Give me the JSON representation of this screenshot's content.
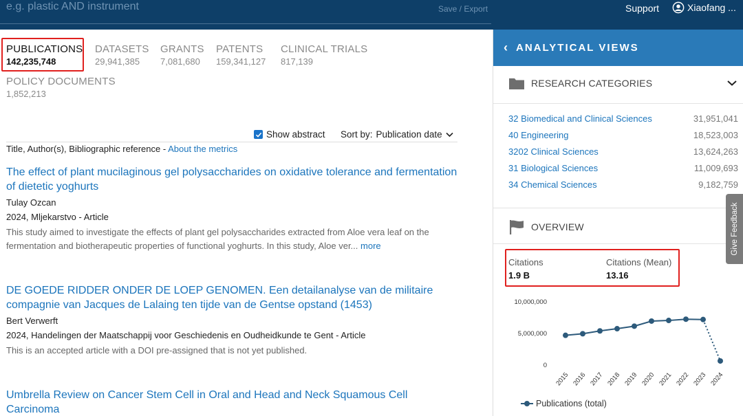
{
  "search": {
    "placeholder": "e.g. plastic AND instrument",
    "save_export": "Save / Export"
  },
  "header": {
    "support": "Support",
    "user_name": "Xiaofang ..."
  },
  "tabs": [
    {
      "label": "PUBLICATIONS",
      "count": "142,235,748",
      "active": true
    },
    {
      "label": "DATASETS",
      "count": "29,941,385"
    },
    {
      "label": "GRANTS",
      "count": "7,081,680"
    },
    {
      "label": "PATENTS",
      "count": "159,341,127"
    },
    {
      "label": "CLINICAL TRIALS",
      "count": "817,139"
    },
    {
      "label": "POLICY DOCUMENTS",
      "count": "1,852,213"
    }
  ],
  "controls": {
    "show_abstract": "Show abstract",
    "show_abstract_checked": true,
    "sort_label": "Sort by:",
    "sort_value": "Publication date",
    "meta_prefix": "Title, Author(s), Bibliographic reference - ",
    "meta_link": "About the metrics"
  },
  "results": [
    {
      "title": "The effect of plant mucilaginous gel polysaccharides on oxidative tolerance and fermentation of dietetic yoghurts",
      "author": "Tulay Ozcan",
      "source": "2024, Mljekarstvo - Article",
      "abstract": "This study aimed to investigate the effects of plant gel polysaccharides extracted from Aloe vera leaf on the fermentation and biotherapeutic properties of functional yoghurts. In this study, Aloe ver...",
      "more": "more"
    },
    {
      "title": "DE GOEDE RIDDER ONDER DE LOEP GENOMEN. Een detailanalyse van de militaire compagnie van Jacques de Lalaing ten tijde van de Gentse opstand (1453)",
      "author": "Bert Verwerft",
      "source": "2024, Handelingen der Maatschappij voor Geschiedenis en Oudheidkunde te Gent - Article",
      "abstract": "This is an accepted article with a DOI pre-assigned that is not yet published."
    },
    {
      "title": "Umbrella Review on Cancer Stem Cell in Oral and Head and Neck Squamous Cell Carcinoma"
    }
  ],
  "analytical_views": {
    "title": "ANALYTICAL VIEWS",
    "categories_title": "RESEARCH CATEGORIES",
    "categories": [
      {
        "name": "32 Biomedical and Clinical Sciences",
        "value": "31,951,041"
      },
      {
        "name": "40 Engineering",
        "value": "18,523,003"
      },
      {
        "name": "3202 Clinical Sciences",
        "value": "13,624,263"
      },
      {
        "name": "31 Biological Sciences",
        "value": "11,009,693"
      },
      {
        "name": "34 Chemical Sciences",
        "value": "9,182,759"
      }
    ],
    "overview_title": "OVERVIEW",
    "stats": [
      {
        "label": "Citations",
        "value": "1.9 B"
      },
      {
        "label": "Citations (Mean)",
        "value": "13.16"
      }
    ]
  },
  "feedback": "Give Feedback",
  "colors": {
    "header": "#0e3f68",
    "accent": "#2a7ab8",
    "link": "#1c75bc",
    "highlight": "#e0201e",
    "series": "#2d5a7b"
  },
  "chart_data": {
    "type": "line",
    "x": [
      "2015",
      "2016",
      "2017",
      "2018",
      "2019",
      "2020",
      "2021",
      "2022",
      "2023",
      "2024"
    ],
    "series": [
      {
        "name": "Publications (total)",
        "values": [
          4600000,
          4850000,
          5300000,
          5650000,
          6050000,
          6850000,
          6950000,
          7150000,
          7100000,
          550000
        ]
      }
    ],
    "y_ticks": [
      "10,000,000",
      "5,000,000",
      "0"
    ],
    "ylim": [
      0,
      10000000
    ],
    "last_segment_dotted": true,
    "legend": "bottom-left"
  }
}
